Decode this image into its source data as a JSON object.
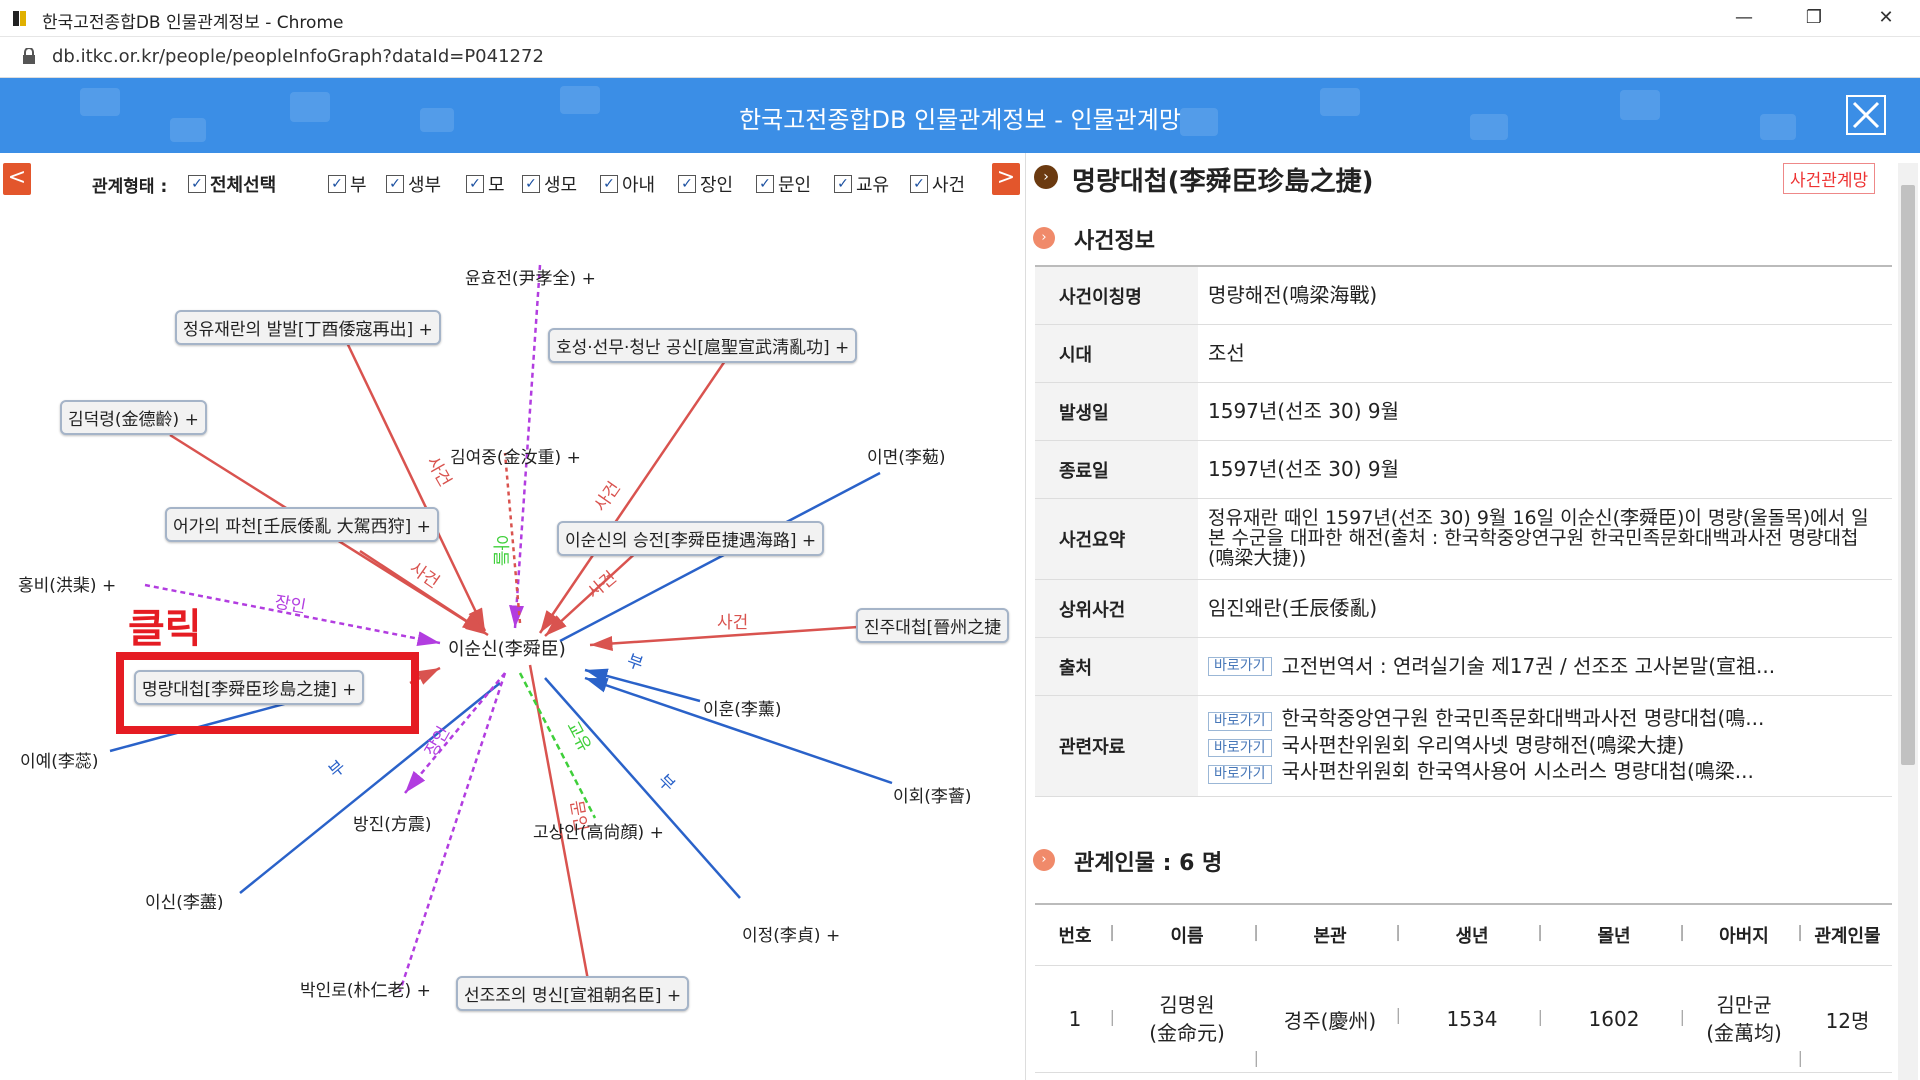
{
  "browser": {
    "window_title": "한국고전종합DB 인물관계정보 - Chrome",
    "url": "db.itkc.or.kr/people/peopleInfoGraph?dataId=P041272",
    "minimize": "—",
    "restore": "❐",
    "close": "✕"
  },
  "banner": {
    "title": "한국고전종합DB 인물관계정보 - 인물관계망"
  },
  "filters": {
    "label": "관계형태 :",
    "select_all": "전체선택",
    "items": [
      "부",
      "생부",
      "모",
      "생모",
      "아내",
      "장인",
      "문인",
      "교유",
      "사건"
    ],
    "prev": "<",
    "next": ">"
  },
  "graph": {
    "center": "이순신(李舜臣)",
    "nodes": {
      "yunhyojeon": "윤효전(尹孝全) +",
      "jeongyu": "정유재란의 발발[丁酉倭寇再出] +",
      "hoseong": "호성·선무·청난 공신[扈聖宣武淸亂功] +",
      "gimdeokryeong": "김덕령(金德齡) +",
      "gimyeojung": "김여중(金汝重) +",
      "imyeon": "이면(李葂)",
      "eoga": "어가의 파천[壬辰倭亂 大駕西狩] +",
      "isunsin_death": "이순신의 승전[李舜臣捷遇海路] +",
      "hongbi": "홍비(洪棐) +",
      "jinju": "진주대첩[晉州之捷",
      "myeongnyang": "명량대첩[李舜臣珍島之捷] +",
      "iye": "이예(李蕊)",
      "ihun": "이훈(李薰)",
      "bangjin": "방진(方震)",
      "ihoe": "이회(李薈)",
      "gosangan": "고상안(高尙顔) +",
      "isin": "이신(李藎)",
      "ijeong": "이정(李貞) +",
      "parkinro": "박인로(朴仁老) +",
      "seonjo": "선조조의 명신[宣祖朝名臣] +"
    },
    "edge_labels": {
      "sageon1": "사건",
      "sageon2": "사건",
      "sageon3": "사건",
      "sageon4": "사건",
      "sageon5": "사건",
      "jangin1": "장인",
      "jangin2": "장인",
      "bu1": "부",
      "bu2": "부",
      "bu3": "부",
      "gyoyu": "교유",
      "ayeol": "아들",
      "munin": "문인"
    },
    "click_label": "클릭"
  },
  "panel": {
    "title": "명량대첩(李舜臣珍島之捷)",
    "tag_button": "사건관계망",
    "event_section": "사건정보",
    "rows": [
      {
        "key": "사건이칭명",
        "value": "명량해전(鳴梁海戰)"
      },
      {
        "key": "시대",
        "value": "조선"
      },
      {
        "key": "발생일",
        "value": "1597년(선조 30) 9월"
      },
      {
        "key": "종료일",
        "value": "1597년(선조 30) 9월"
      },
      {
        "key": "사건요약",
        "value": "정유재란 때인 1597년(선조 30) 9월 16일 이순신(李舜臣)이 명량(울돌목)에서 일본 수군을 대파한 해전(출처 : 한국학중앙연구원 한국민족문화대백과사전 명량대첩(鳴梁大捷))"
      },
      {
        "key": "상위사건",
        "value": "임진왜란(壬辰倭亂)"
      }
    ],
    "source_key": "출처",
    "goto": "바로가기",
    "source_value": "고전번역서 : 연려실기술 제17권 / 선조조 고사본말(宣祖...",
    "related_key": "관련자료",
    "related": [
      "한국학중앙연구원 한국민족문화대백과사전 명량대첩(鳴...",
      "국사편찬위원회 우리역사넷 명량해전(鳴梁大捷)",
      "국사편찬위원회 한국역사용어 시소러스 명량대첩(鳴梁..."
    ],
    "people_section": "관계인물 : 6 명",
    "people_headers": [
      "번호",
      "이름",
      "본관",
      "생년",
      "몰년",
      "아버지",
      "관계인물"
    ],
    "people_rows": [
      {
        "no": "1",
        "name": "김명원",
        "name_hanja": "(金命元)",
        "bongwan": "경주(慶州)",
        "born": "1534",
        "died": "1602",
        "father": "김만균",
        "father_hanja": "(金萬均)",
        "related": "12명"
      }
    ]
  }
}
